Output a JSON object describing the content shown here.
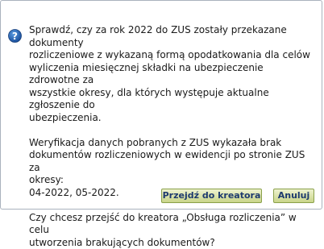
{
  "dialog": {
    "icon": "question-icon",
    "paragraphs": [
      "Sprawdź, czy za rok 2022 do ZUS zostały przekazane dokumenty\nrozliczeniowe z wykazaną formą opodatkowania dla celów\nwyliczenia miesięcznej składki na ubezpieczenie zdrowotne za\nwszystkie okresy, dla których występuje aktualne zgłoszenie do\nubezpieczenia.",
      "Weryfikacja danych pobranych z ZUS wykazała brak\ndokumentów rozliczeniowych w ewidencji po stronie ZUS za\nokresy:\n04-2022, 05-2022.",
      "Czy chcesz przejść do kreatora „Obsługa rozliczenia” w celu\nutworzenia brakujących dokumentów?"
    ],
    "buttons": {
      "primary_label": "Przejdź do kreatora",
      "cancel_label": "Anuluj"
    },
    "colors": {
      "icon_fill": "#1f5fb0",
      "button_gradient_top": "#eef2cf",
      "button_gradient_bottom": "#c9d58a",
      "button_text": "#1e3a6e"
    }
  }
}
